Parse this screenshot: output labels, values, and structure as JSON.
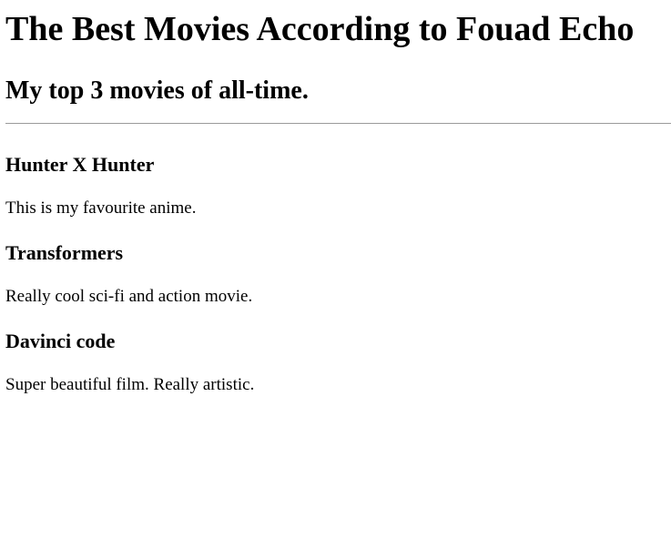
{
  "page": {
    "title": "The Best Movies According to Fouad Echo",
    "subtitle": "My top 3 movies of all-time."
  },
  "movies": [
    {
      "title": "Hunter X Hunter",
      "description": "This is my favourite anime."
    },
    {
      "title": "Transformers",
      "description": "Really cool sci-fi and action movie."
    },
    {
      "title": "Davinci code",
      "description": "Super beautiful film. Really artistic."
    }
  ]
}
